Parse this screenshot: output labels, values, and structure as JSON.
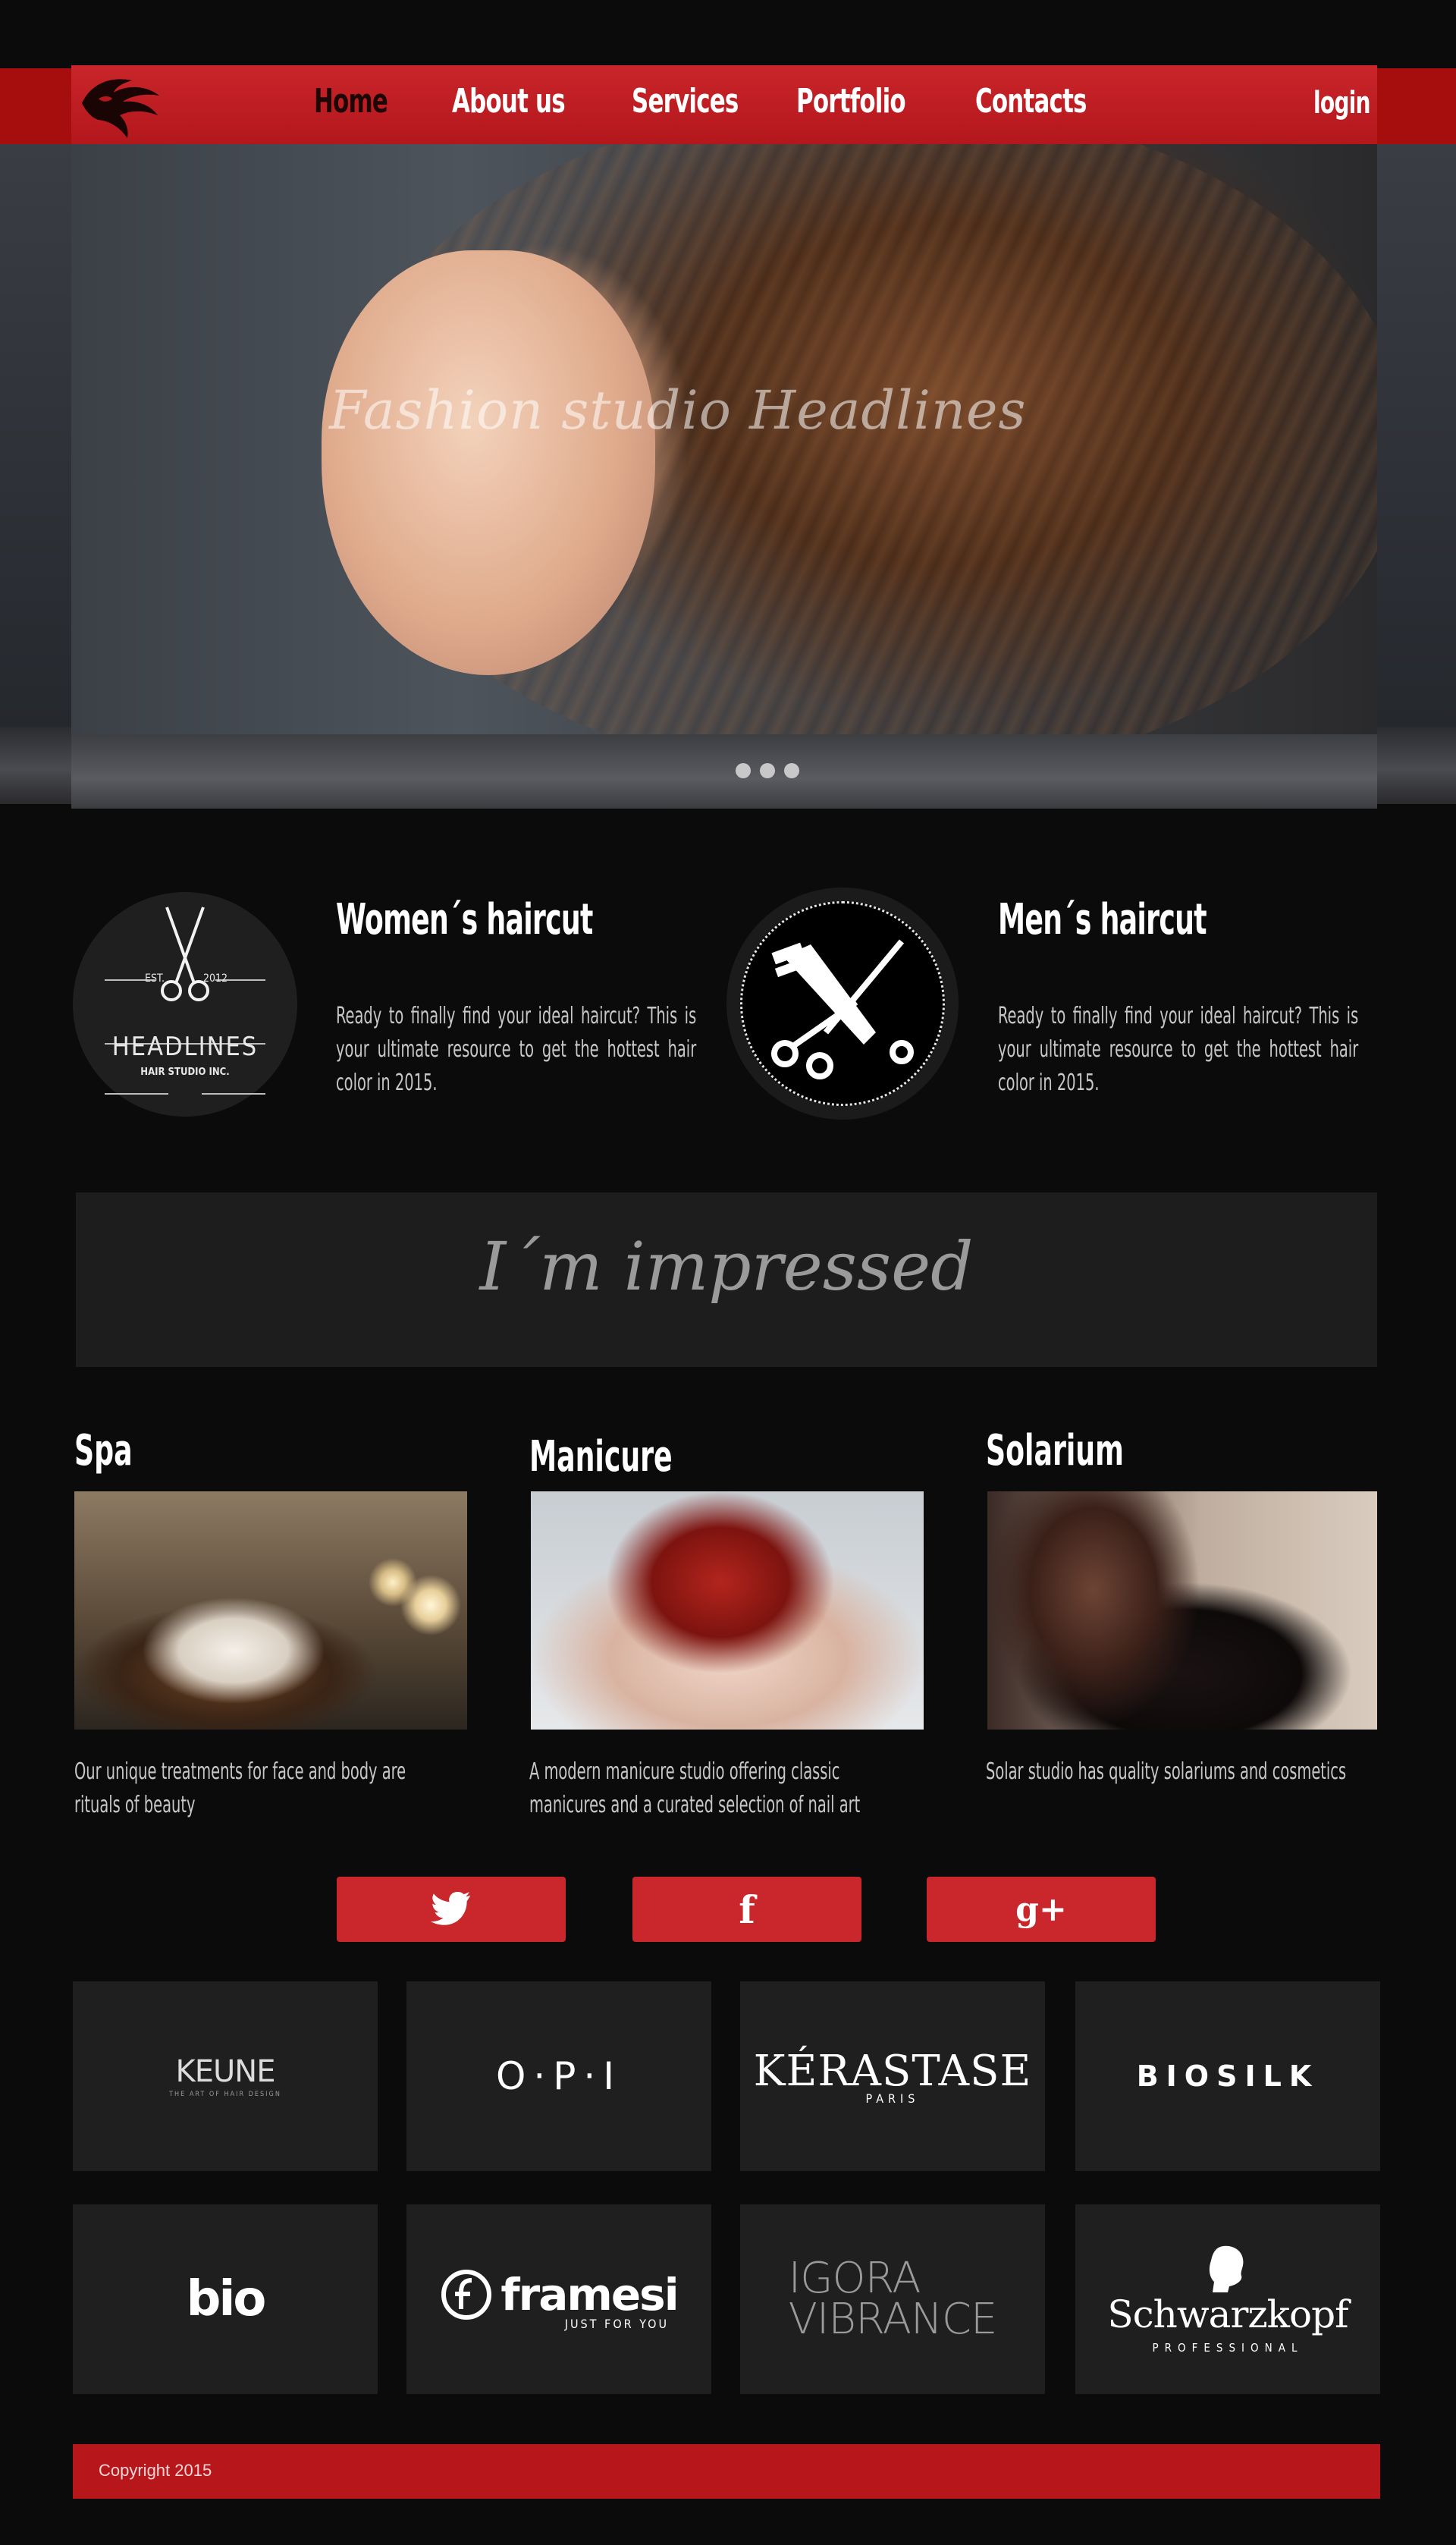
{
  "nav": {
    "items": [
      "Home",
      "About us",
      "Services",
      "Portfolio",
      "Contacts"
    ],
    "login": "login"
  },
  "hero": {
    "title": "Fashion studio Headlines",
    "slides": 3
  },
  "features": {
    "women": {
      "title": "Women´s haircut",
      "text": "Ready to finally find your ideal haircut? This is your ultimate resource to get the hottest hair color in 2015.",
      "badge": {
        "est": "EST.",
        "year": "2012",
        "brand": "HEADLINES",
        "sub": "HAIR STUDIO INC."
      }
    },
    "men": {
      "title": "Men´s haircut",
      "text": "Ready to finally find your ideal haircut? This is your ultimate resource to get the hottest hair color in 2015."
    }
  },
  "impressed": "I´m impressed",
  "services": [
    {
      "title": "Spa",
      "text": "Our unique treatments for face and body are rituals of beauty"
    },
    {
      "title": "Manicure",
      "text": "A modern manicure studio offering classic manicures and a curated selection of nail art"
    },
    {
      "title": "Solarium",
      "text": "Solar studio has quality solariums and cosmetics"
    }
  ],
  "social": [
    "twitter-icon",
    "facebook-icon",
    "google-plus-icon"
  ],
  "social_glyphs": {
    "facebook": "f",
    "google": "g+"
  },
  "brands": {
    "keune": {
      "name": "KEUNE",
      "sub": "THE ART OF HAIR DESIGN"
    },
    "opi": "O·P·I",
    "kerastase": {
      "name": "KÉRASTASE",
      "sub": "PARIS"
    },
    "biosilk": "BIOSILK",
    "bio": "bio",
    "framesi": {
      "name": "framesi",
      "sub": "JUST FOR YOU"
    },
    "igora": {
      "line1": "IGORA",
      "line2": "VIBRANCE"
    },
    "schwarzkopf": {
      "name": "Schwarzkopf",
      "sub": "PROFESSIONAL"
    }
  },
  "footer": "Copyright 2015",
  "colors": {
    "accent": "#c9272c",
    "band": "#a60e0e",
    "background": "#0b0b0c",
    "tile": "#1f1f20"
  }
}
